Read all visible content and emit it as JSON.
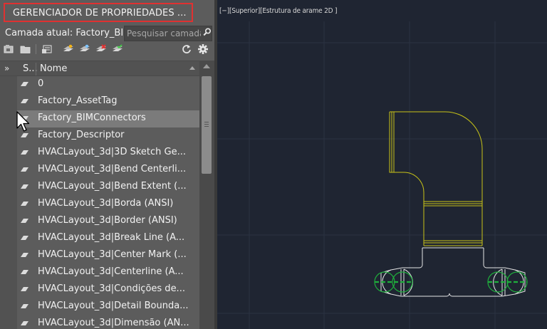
{
  "panel": {
    "title": "GERENCIADOR DE PROPRIEDADES ...",
    "current_layer": "Camada atual: Factory_BIMConnectors",
    "search_placeholder": "Pesquisar camada",
    "toolbar": {
      "icons": [
        "layer-states-icon",
        "layer-folder-icon",
        "layer-settings-icon",
        "new-layer-icon",
        "new-layer-frozen-icon",
        "delete-layer-icon",
        "set-current-icon",
        "refresh-icon",
        "settings-gear-icon"
      ]
    },
    "header": {
      "status_col": "S...",
      "name_col": "Nome"
    },
    "layers": [
      "0",
      "Factory_AssetTag",
      "Factory_BIMConnectors",
      "Factory_Descriptor",
      "HVACLayout_3d|3D Sketch Ge...",
      "HVACLayout_3d|Bend Centerli...",
      "HVACLayout_3d|Bend Extent (...",
      "HVACLayout_3d|Borda (ANSI)",
      "HVACLayout_3d|Border (ANSI)",
      "HVACLayout_3d|Break Line (A...",
      "HVACLayout_3d|Center Mark (...",
      "HVACLayout_3d|Centerline (A...",
      "HVACLayout_3d|Condições de...",
      "HVACLayout_3d|Detail Bounda...",
      "HVACLayout_3d|Dimensão (AN..."
    ],
    "selected_layer": "Factory_BIMConnectors"
  },
  "viewport": {
    "label": "[−][Superior][Estrutura de arame 2D ]",
    "colors": {
      "background": "#1f2532",
      "grid": "#2b3242",
      "duct": "#c8c418",
      "outline": "#e6e6e6",
      "connector": "#1fae3c"
    }
  }
}
